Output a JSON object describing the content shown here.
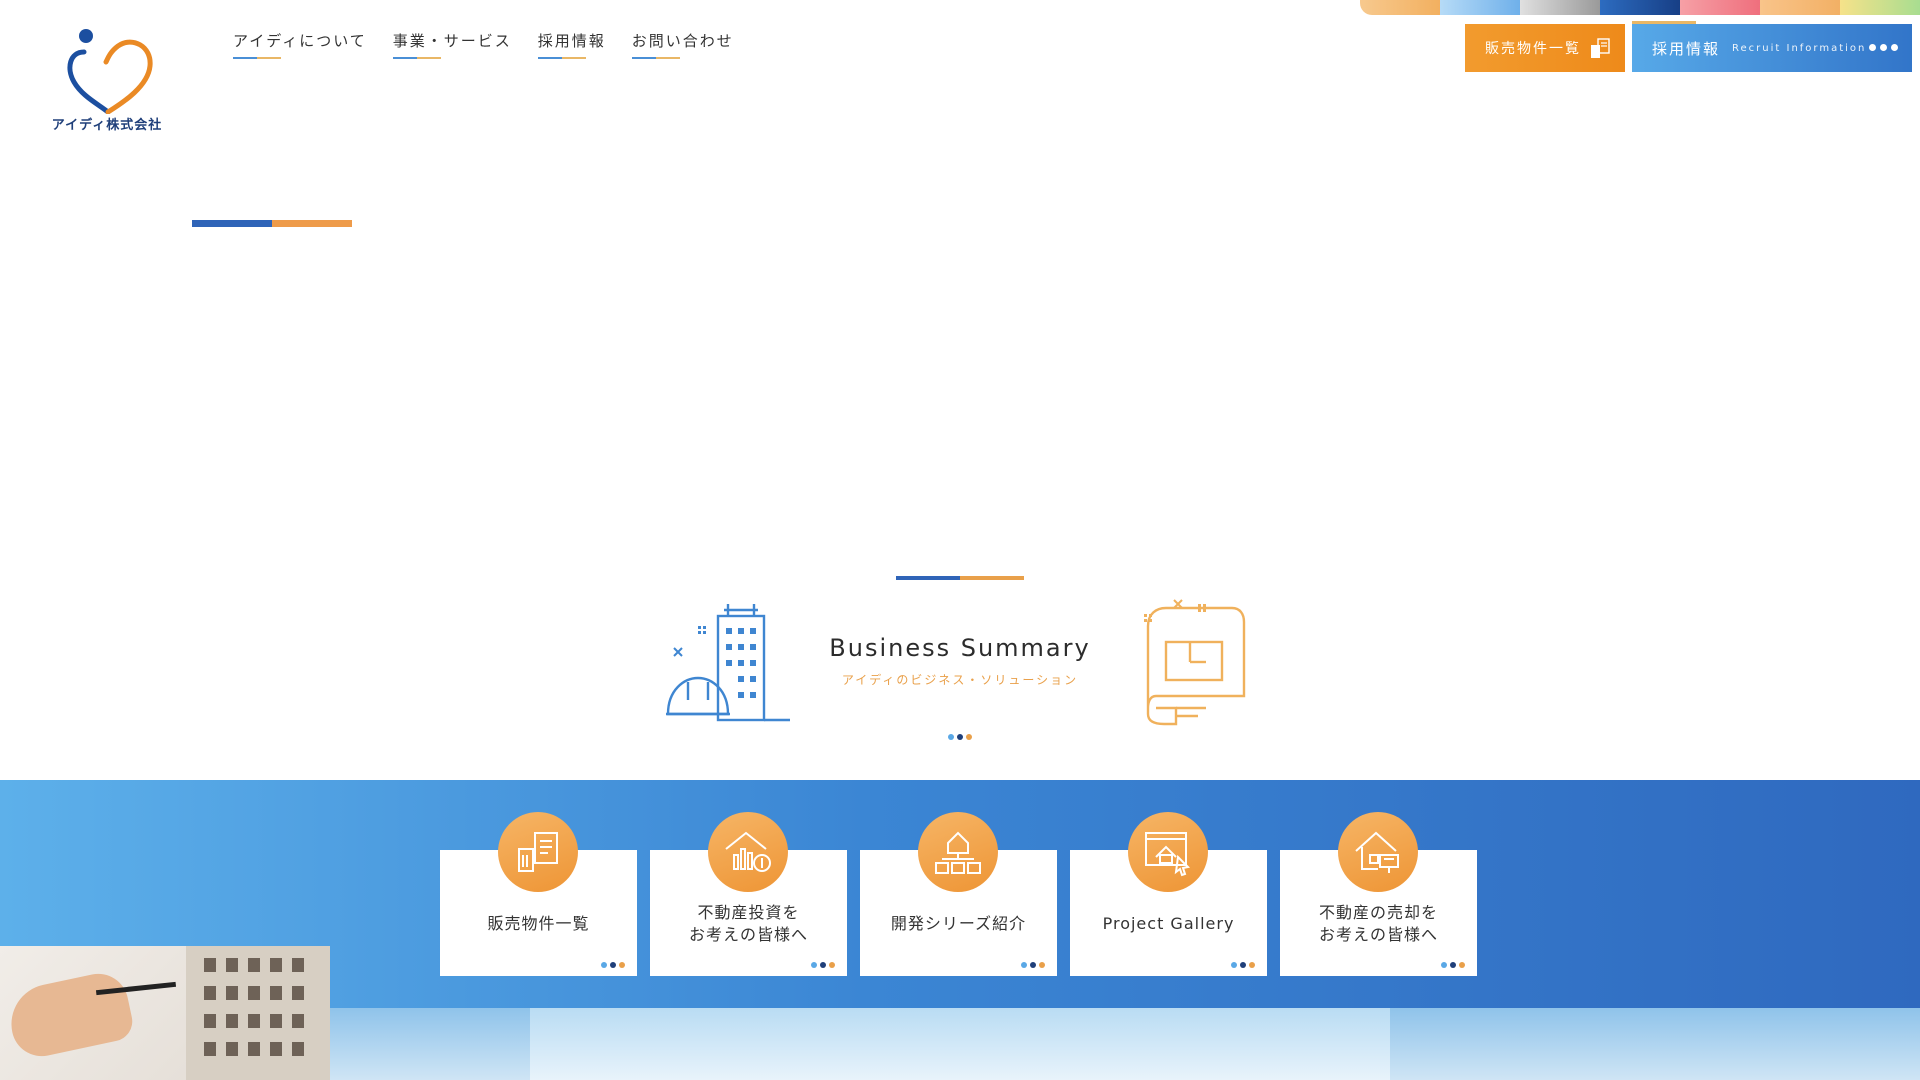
{
  "colors": {
    "accent_blue": "#3b7ec8",
    "accent_orange": "#ee9535",
    "stripe": [
      "#f2b86a",
      "#8fc2ee",
      "#bdbdbd",
      "#1f4f9a",
      "#f2838f",
      "#f5c27a",
      "#b7e08f"
    ]
  },
  "header": {
    "logo_text": "アイディ株式会社",
    "nav": [
      {
        "label": "アイディについて"
      },
      {
        "label": "事業・サービス"
      },
      {
        "label": "採用情報"
      },
      {
        "label": "お問い合わせ"
      }
    ],
    "sales_button": {
      "label": "販売物件一覧",
      "icon": "building-document-icon"
    },
    "recruit_button": {
      "label": "採用情報",
      "sublabel": "Recruit Information",
      "icon": "more-dots-icon"
    }
  },
  "business_summary": {
    "title": "Business Summary",
    "subtitle": "アイディのビジネス・ソリューション",
    "left_icon": "building-helmet-icon",
    "right_icon": "blueprint-icon"
  },
  "cards": [
    {
      "line1": "販売物件一覧",
      "line2": "",
      "icon": "property-list-icon"
    },
    {
      "line1": "不動産投資を",
      "line2": "お考えの皆様へ",
      "icon": "investment-house-icon"
    },
    {
      "line1": "開発シリーズ紹介",
      "line2": "",
      "icon": "development-series-icon"
    },
    {
      "line1": "Project Gallery",
      "line2": "",
      "icon": "gallery-icon"
    },
    {
      "line1": "不動産の売却を",
      "line2": "お考えの皆様へ",
      "icon": "sell-house-icon"
    }
  ]
}
